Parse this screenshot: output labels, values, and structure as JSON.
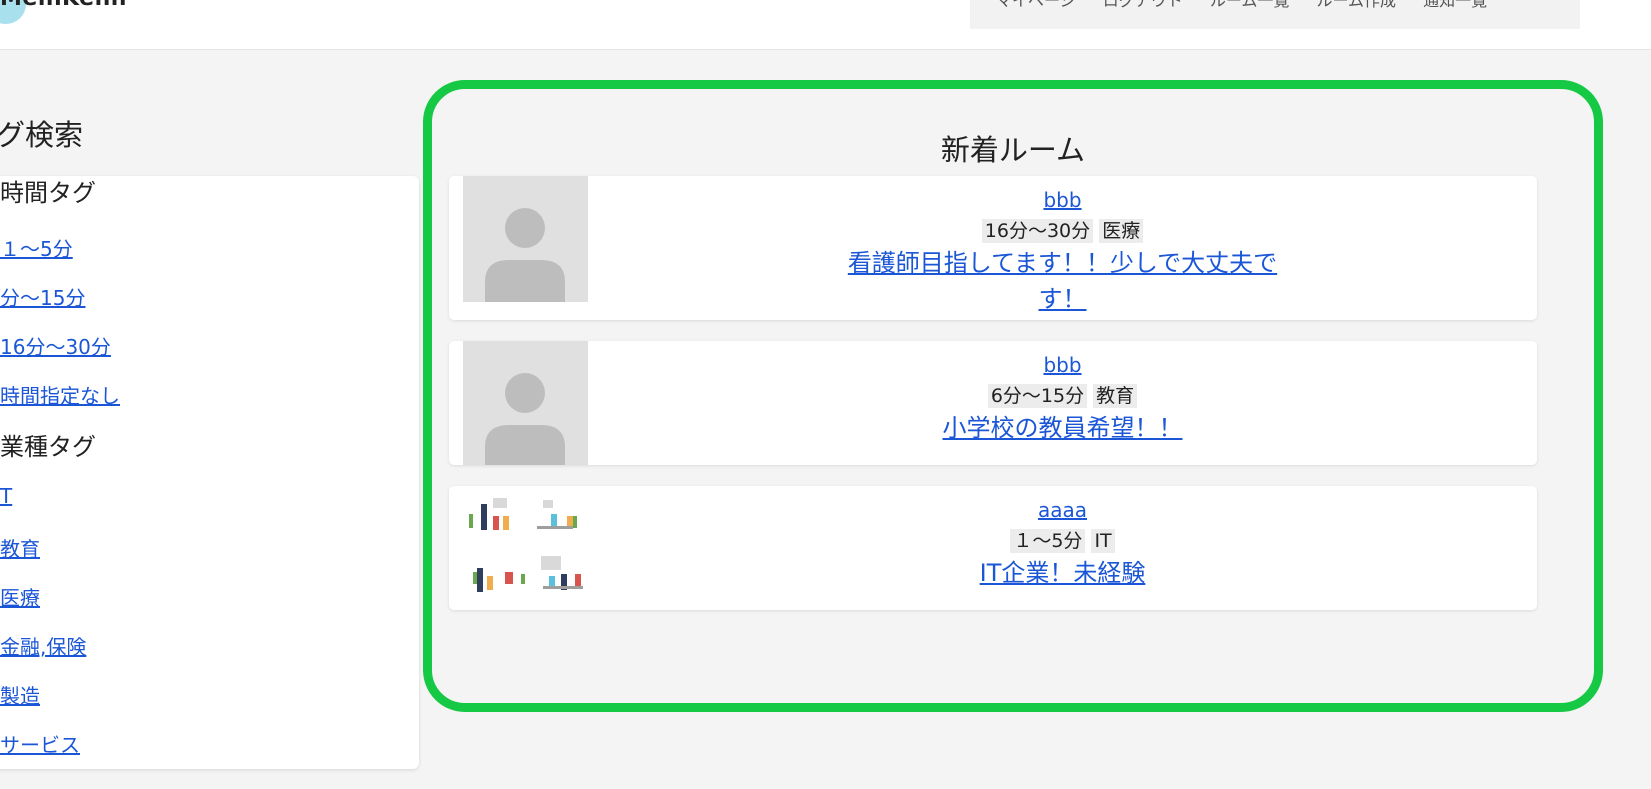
{
  "brand": {
    "logo_text": "MeihKehh"
  },
  "nav": {
    "items": [
      "マイページ",
      "ログアウト",
      "ルーム一覧",
      "ルーム作成",
      "通知一覧"
    ]
  },
  "sidebar": {
    "title": "グ検索",
    "time_group": {
      "heading": "時間タグ",
      "items": [
        "１〜5分",
        "分〜15分",
        "16分〜30分",
        "時間指定なし"
      ]
    },
    "industry_group": {
      "heading": "業種タグ",
      "items": [
        "T",
        "教育",
        "医療",
        "金融,保険",
        "製造",
        "サービス"
      ]
    }
  },
  "rooms": {
    "title": "新着ルーム",
    "items": [
      {
        "user": "bbb",
        "time_tag": "16分〜30分",
        "industry_tag": "医療",
        "title": "看護師目指してます！！少しで大丈夫です！",
        "thumbnail": "default-avatar"
      },
      {
        "user": "bbb",
        "time_tag": "6分〜15分",
        "industry_tag": "教育",
        "title": "小学校の教員希望！！",
        "thumbnail": "default-avatar"
      },
      {
        "user": "aaaa",
        "time_tag": "１〜5分",
        "industry_tag": "IT",
        "title": "IT企業！未経験",
        "thumbnail": "office-illustration"
      }
    ]
  },
  "colors": {
    "link": "#1a56d6",
    "frame_highlight": "#16c944",
    "background": "#f4f4f4"
  }
}
